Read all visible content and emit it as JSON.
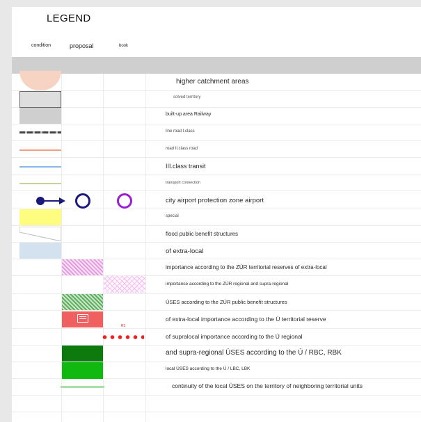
{
  "legend": {
    "title": "LEGEND",
    "columns": {
      "condition": "condition",
      "proposal": "proposal",
      "book": "book"
    },
    "items": [
      {
        "label": "higher catchment areas"
      },
      {
        "label": "solved territory"
      },
      {
        "label": "built-up area Railway"
      },
      {
        "label": "line road I.class"
      },
      {
        "label": "road II.class road"
      },
      {
        "label": "III.class transit"
      },
      {
        "label": "transport connection"
      },
      {
        "label": "city airport protection zone airport"
      },
      {
        "label": "special"
      },
      {
        "label": "flood public benefit structures"
      },
      {
        "label": "of extra-local"
      },
      {
        "label": "importance according to the ZÚR territorial reserves of extra-local"
      },
      {
        "label": "importance according to the ZÚR regional and supra-regional"
      },
      {
        "label": "ÚSES according to the ZÚR public benefit structures"
      },
      {
        "label": "of extra-local importance according to the Ú territorial reserve"
      },
      {
        "label": "of supralocal importance according to the Ú regional"
      },
      {
        "label": "and supra-regional ÚSES according to the Ú / RBC, RBK"
      },
      {
        "label": "local ÚSES according to the Ú / LBC, LBK"
      },
      {
        "label": "continuity of the local ÚSES on the territory of neighboring territorial units"
      }
    ],
    "marker_r1": "R1",
    "colors": {
      "catchment": "#f7d3c4",
      "navy": "#1a1a7a",
      "purple": "#9a1fd0",
      "yellow": "#fffd80",
      "light_blue": "#d3e2ee",
      "magenta_hatch": "#e59be0",
      "green_hatch": "#5fae5f",
      "red_box": "#f06060",
      "red_dots": "#ee2222",
      "dark_green": "#0c7a0c",
      "green": "#10b810",
      "light_green": "#a8e0a8"
    }
  }
}
